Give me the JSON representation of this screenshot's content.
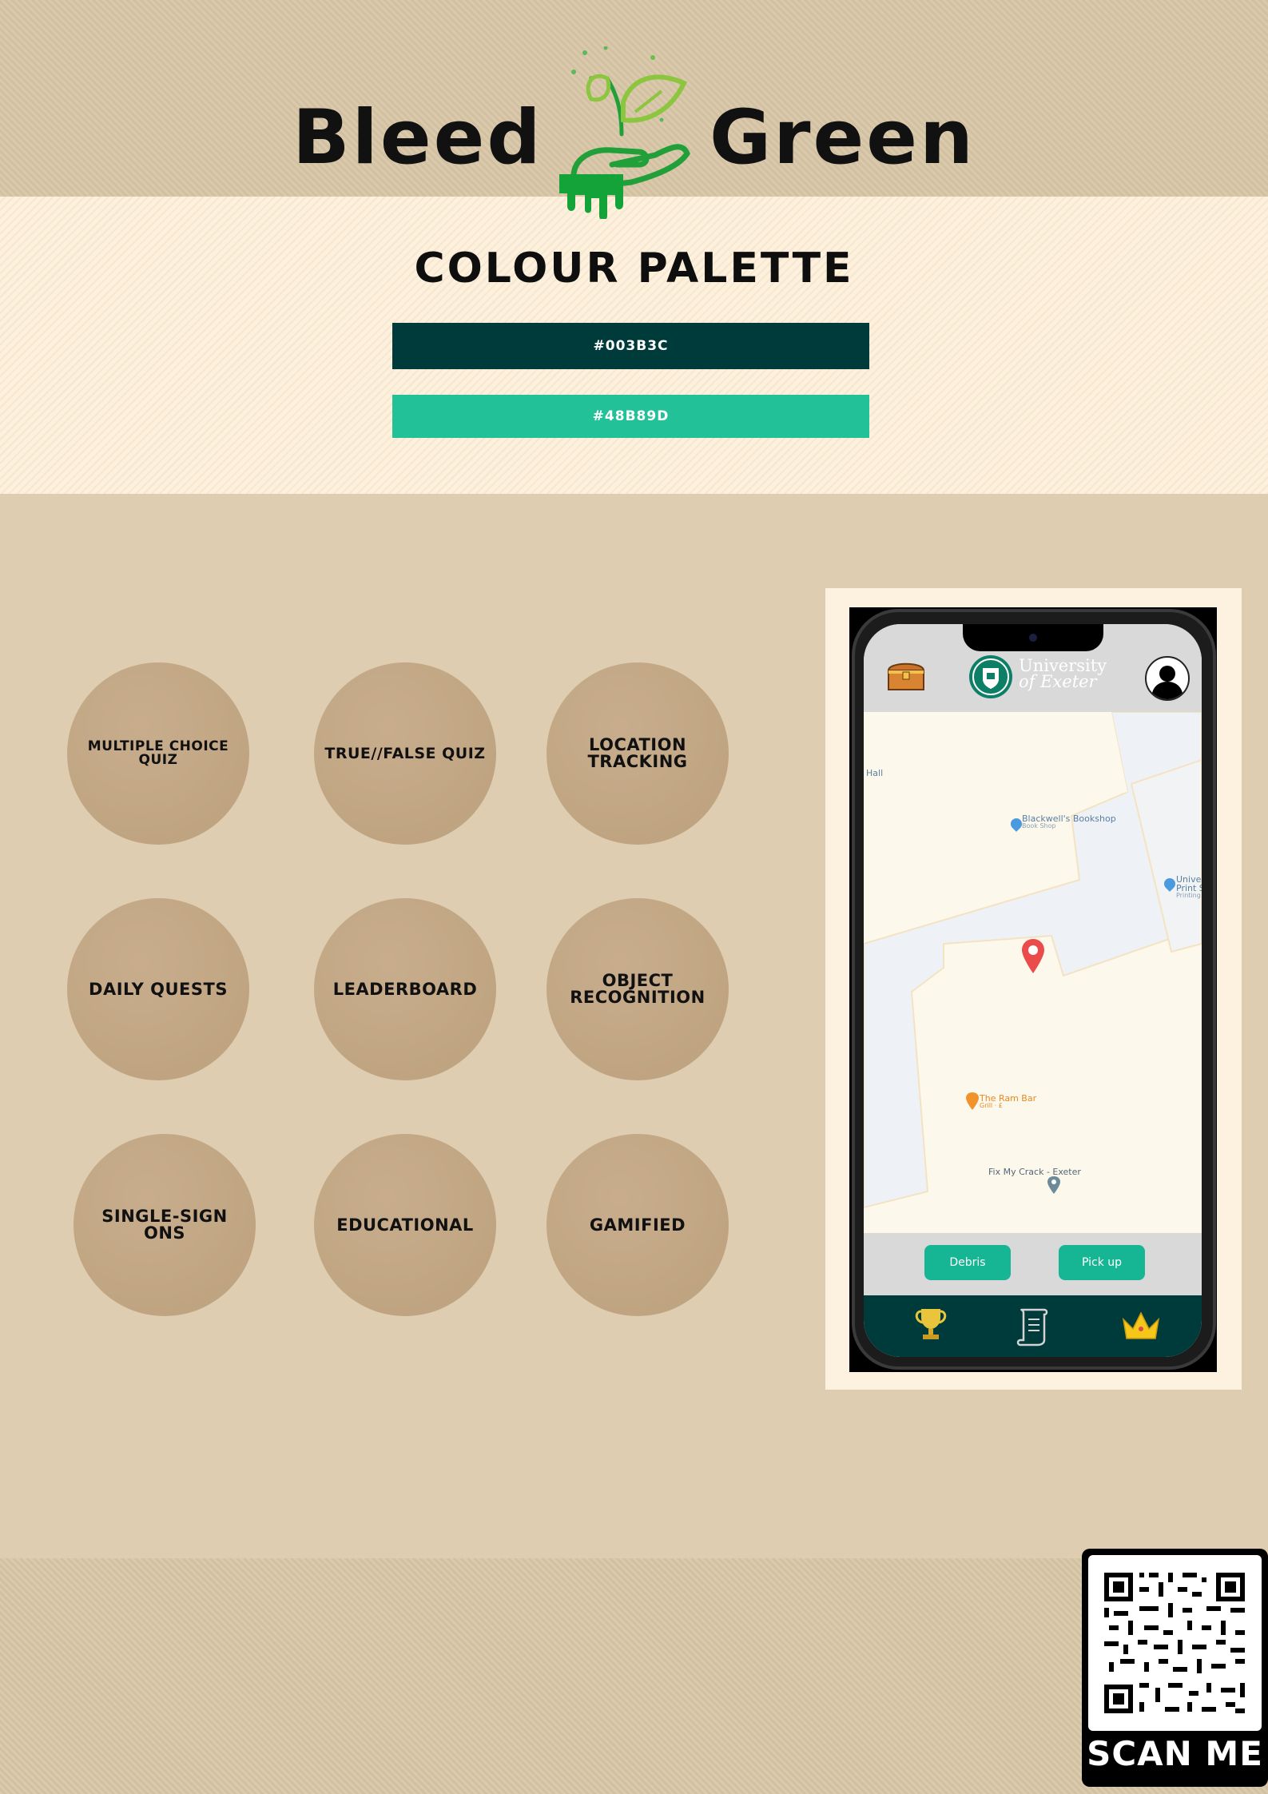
{
  "brand": {
    "word_left": "Bleed",
    "word_right": "Green"
  },
  "palette": {
    "title": "COLOUR PALETTE",
    "swatches": [
      {
        "label": "#003B3C",
        "color": "#003B3C"
      },
      {
        "label": "#48B89D",
        "color": "#22C198"
      }
    ]
  },
  "features": [
    "MULTIPLE CHOICE QUIZ",
    "TRUE//FALSE QUIZ",
    "LOCATION TRACKING",
    "DAILY QUESTS",
    "LEADERBOARD",
    "OBJECT RECOGNITION",
    "SINGLE-SIGN ONS",
    "EDUCATIONAL",
    "GAMIFIED"
  ],
  "phone": {
    "university_line1": "University",
    "university_line2": "of Exeter",
    "map": {
      "hall": "Hall",
      "poi1_name": "Blackwell's Bookshop",
      "poi1_type": "Book Shop",
      "poi2_name": "Univer",
      "poi2_line2": "Print S",
      "poi2_line3": "Printing",
      "poi3_name": "The Ram Bar",
      "poi3_type": "Grill · £",
      "poi4_name": "Fix My Crack - Exeter"
    },
    "buttons": {
      "debris": "Debris",
      "pickup": "Pick up"
    },
    "icons": [
      "treasure-chest-icon",
      "profile-icon",
      "trophy-icon",
      "scroll-icon",
      "crown-icon"
    ]
  },
  "qr": {
    "label": "SCAN ME"
  },
  "colors": {
    "primary": "#003B3C",
    "accent": "#48B89D",
    "background": "#DECDB0",
    "panel": "#FDF1E0"
  }
}
